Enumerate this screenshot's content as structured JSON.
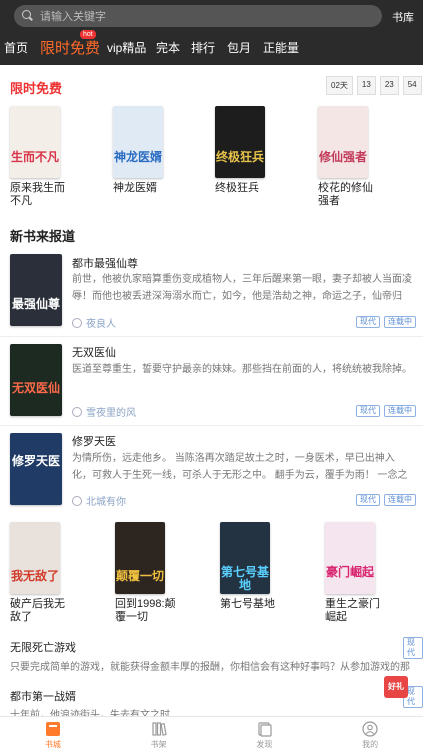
{
  "search": {
    "placeholder": "请输入关键字",
    "shelf_label": "书库"
  },
  "nav": {
    "tabs": [
      "首页",
      "限时免费",
      "vip精品",
      "完本",
      "排行",
      "包月",
      "正能量"
    ],
    "active_index": 1,
    "hot_badge": "hot"
  },
  "free": {
    "title": "限时免费",
    "countdown": [
      "02天",
      "13",
      "23",
      "54"
    ],
    "books": [
      {
        "name": "原来我生而不凡",
        "cover_text": "生而不凡",
        "bg": "#f3eee8",
        "fg": "#d9344a"
      },
      {
        "name": "神龙医婿",
        "cover_text": "神龙医婿",
        "bg": "#dfeaf5",
        "fg": "#2a6bc2"
      },
      {
        "name": "终极狂兵",
        "cover_text": "终极狂兵",
        "bg": "#1d1d1d",
        "fg": "#e8c34a"
      },
      {
        "name": "校花的修仙强者",
        "cover_text": "修仙强者",
        "bg": "#f5e6e6",
        "fg": "#c23a5a"
      }
    ]
  },
  "new_books": {
    "title": "新书来报道",
    "items": [
      {
        "title": "都市最强仙尊",
        "desc": "前世，他被仇家暗算重伤变成植物人，三年后醒来第一眼，妻子却被人当面凌辱！而他也被丢进深海溺水而亡，如今，他是浩劫之神，命运之子，仙帝归来，",
        "author": "夜良人",
        "tags": [
          "现代",
          "连载中"
        ],
        "cover_text": "最强仙尊",
        "bg": "#2a2f3a",
        "fg": "#ffffff"
      },
      {
        "title": "无双医仙",
        "desc": "医道至尊重生，誓要守护最亲的妹妹。那些挡在前面的人，将统统被我除掉。",
        "author": "雪夜里的风",
        "tags": [
          "现代",
          "连载中"
        ],
        "cover_text": "无双医仙",
        "bg": "#1d2a22",
        "fg": "#ff6a4a"
      },
      {
        "title": "修罗天医",
        "desc": "为情所伤，远走他乡。 当陈洛再次踏足故土之时，一身医术，早已出神入化，可救人于生死一线，可杀人于无形之中。 翻手为云，覆手为雨！ 一念之间，决断",
        "author": "北城有你",
        "tags": [
          "现代",
          "连载中"
        ],
        "cover_text": "修罗天医",
        "bg": "#1f3b66",
        "fg": "#ffffff"
      }
    ]
  },
  "grid_books": [
    {
      "name": "破产后我无敌了",
      "cover_text": "我无敌了",
      "bg": "#e9e1db",
      "fg": "#d23a2a"
    },
    {
      "name": "回到1998:颠覆一切",
      "cover_text": "颠覆一切",
      "bg": "#2c2520",
      "fg": "#f0c040"
    },
    {
      "name": "第七号基地",
      "cover_text": "第七号基地",
      "bg": "#233341",
      "fg": "#59d0ff"
    },
    {
      "name": "重生之豪门崛起",
      "cover_text": "豪门崛起",
      "bg": "#f5e5ef",
      "fg": "#d9256f"
    }
  ],
  "list": [
    {
      "title": "无限死亡游戏",
      "desc": "只要完成简单的游戏，就能获得金额丰厚的报酬，你相信会有这种好事吗？从参加游戏的那一",
      "tag": "现代"
    },
    {
      "title": "都市第一战婿",
      "desc": "十年前，他浪迹街头，失去有文之时",
      "tag": "现代"
    }
  ],
  "gift_label": "好礼",
  "bottom": {
    "items": [
      "书城",
      "书架",
      "发现",
      "我的"
    ],
    "active_index": 0
  },
  "colors": {
    "accent": "#ff6a2a",
    "red": "#e33333",
    "tag_blue": "#5b8dd6"
  }
}
